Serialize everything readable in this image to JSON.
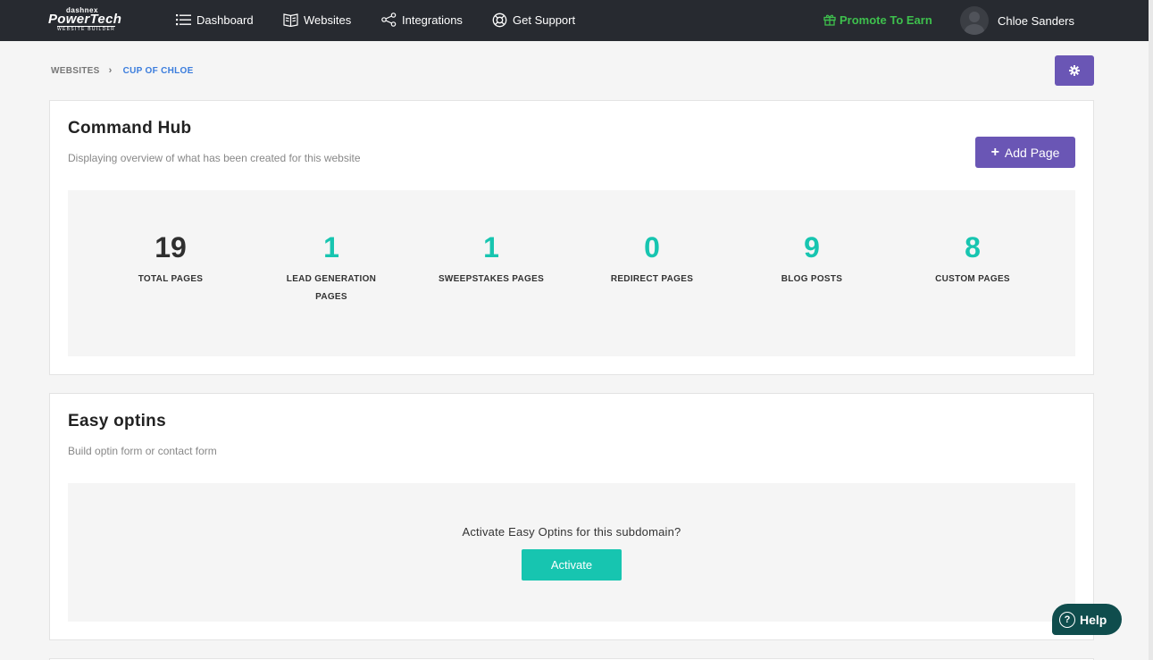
{
  "brand": {
    "small": "dashnex",
    "main": "PowerTech",
    "sub": "WEBSITE BUILDER"
  },
  "nav": {
    "dashboard": "Dashboard",
    "websites": "Websites",
    "integrations": "Integrations",
    "support": "Get Support",
    "promote": "Promote To Earn",
    "user": "Chloe Sanders"
  },
  "breadcrumb": {
    "root": "WEBSITES",
    "separator": "›",
    "current": "CUP OF CHLOE"
  },
  "hub": {
    "title": "Command Hub",
    "subtitle": "Displaying overview of what has been created for this website",
    "add_page": "Add Page",
    "stats": [
      {
        "value": "19",
        "label": "TOTAL PAGES"
      },
      {
        "value": "1",
        "label": "LEAD GENERATION PAGES"
      },
      {
        "value": "1",
        "label": "SWEEPSTAKES PAGES"
      },
      {
        "value": "0",
        "label": "REDIRECT PAGES"
      },
      {
        "value": "9",
        "label": "BLOG POSTS"
      },
      {
        "value": "8",
        "label": "CUSTOM PAGES"
      }
    ]
  },
  "optins": {
    "title": "Easy optins",
    "subtitle": "Build optin form or contact form",
    "question": "Activate Easy Optins for this subdomain?",
    "activate": "Activate"
  },
  "help": {
    "label": "Help",
    "glyph": "?"
  },
  "colors": {
    "topbar": "#272a30",
    "accent_purple": "#6a56b5",
    "accent_teal": "#17c5b0",
    "promote_green": "#3ec04d",
    "link_blue": "#3b7ddd",
    "help_bg": "#0f4d4d"
  },
  "icons": {
    "dashboard": "list-icon",
    "websites": "book-icon",
    "integrations": "share-icon",
    "support": "lifebuoy-icon",
    "promote": "gift-icon",
    "settings": "gear-icon",
    "help": "question-circle-icon"
  }
}
